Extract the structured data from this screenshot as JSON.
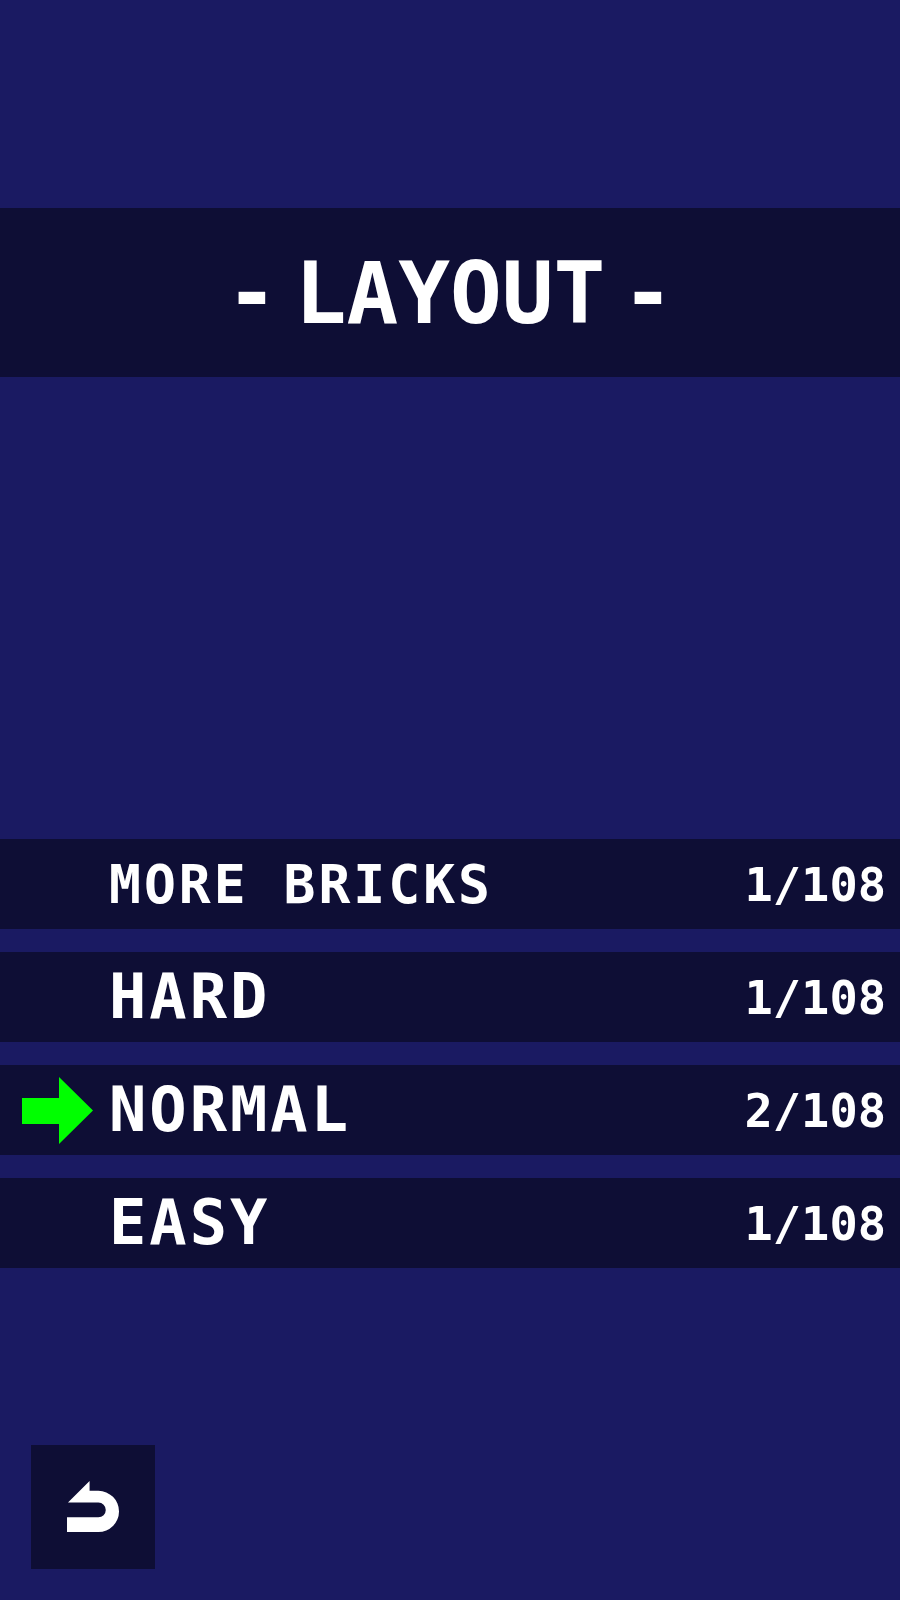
{
  "title": "- LAYOUT -",
  "layouts": [
    {
      "label": "MORE BRICKS",
      "progress": "1/108",
      "selected": false
    },
    {
      "label": "HARD",
      "progress": "1/108",
      "selected": false
    },
    {
      "label": "NORMAL",
      "progress": "2/108",
      "selected": true
    },
    {
      "label": "EASY",
      "progress": "1/108",
      "selected": false
    }
  ]
}
